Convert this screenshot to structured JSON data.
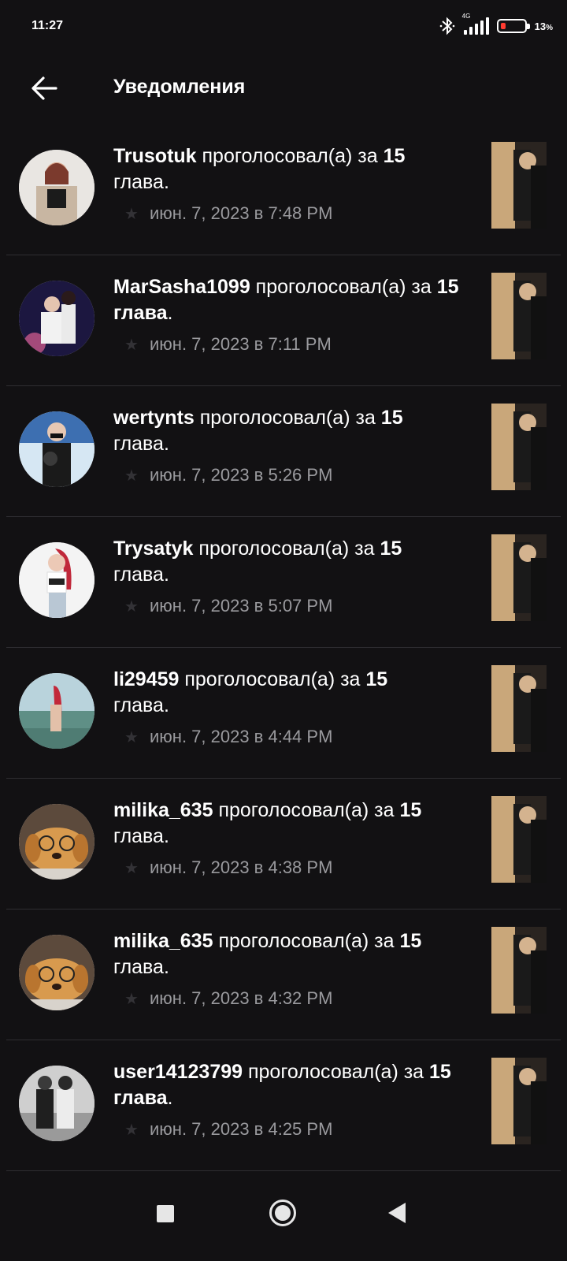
{
  "status_bar": {
    "time": "11:27",
    "network": "4G",
    "battery": "13",
    "battery_suffix": "%"
  },
  "header": {
    "title": "Уведомления",
    "back_icon": "arrow-left-icon"
  },
  "notifications": [
    {
      "user": "Trusotuk",
      "action": " проголосовал(а) за ",
      "chapter": "15",
      "line2": "глава",
      "timestamp": "июн. 7, 2023 в 7:48 PM"
    },
    {
      "user": "MarSasha1099",
      "action": " проголосовал(а) за ",
      "chapter": "15 глава",
      "line2": "",
      "timestamp": "июн. 7, 2023 в 7:11 PM"
    },
    {
      "user": "wertynts",
      "action": " проголосовал(а) за ",
      "chapter": "15",
      "line2": "глава",
      "timestamp": "июн. 7, 2023 в 5:26 PM"
    },
    {
      "user": "Trysatyk",
      "action": " проголосовал(а) за ",
      "chapter": "15",
      "line2": "глава",
      "timestamp": "июн. 7, 2023 в 5:07 PM"
    },
    {
      "user": "li29459",
      "action": " проголосовал(а) за ",
      "chapter": "15",
      "line2": "глава",
      "timestamp": "июн. 7, 2023 в 4:44 PM"
    },
    {
      "user": "milika_635",
      "action": " проголосовал(а) за ",
      "chapter": "15",
      "line2": "глава",
      "timestamp": "июн. 7, 2023 в 4:38 PM"
    },
    {
      "user": "milika_635",
      "action": " проголосовал(а) за ",
      "chapter": "15",
      "line2": "глава",
      "timestamp": "июн. 7, 2023 в 4:32 PM"
    },
    {
      "user": "user14123799",
      "action": " проголосовал(а) за ",
      "chapter": "15 глава",
      "line2": "",
      "timestamp": "июн. 7, 2023 в 4:25 PM"
    }
  ],
  "colors": {
    "background": "#121113",
    "divider": "#2e2d31",
    "muted_text": "#9a9a9e",
    "battery_low": "#ff3b30"
  }
}
